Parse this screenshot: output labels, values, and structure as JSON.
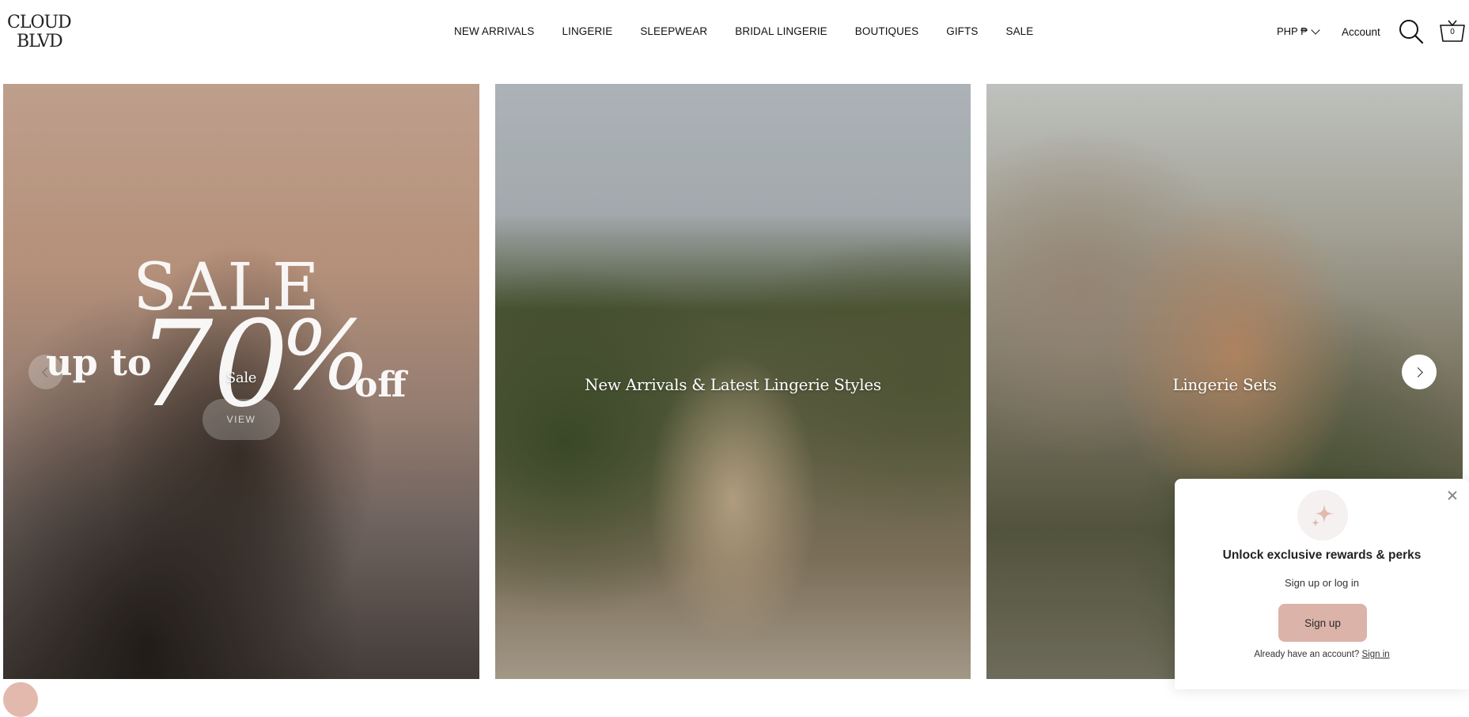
{
  "header": {
    "logo_line1": "CLOUD",
    "logo_line2": "BLVD",
    "nav": [
      "NEW ARRIVALS",
      "LINGERIE",
      "SLEEPWEAR",
      "BRIDAL LINGERIE",
      "BOUTIQUES",
      "GIFTS",
      "SALE"
    ],
    "currency": "PHP ₱",
    "account_label": "Account",
    "cart_count": "0"
  },
  "carousel": {
    "panel1": {
      "sale_word": "SALE",
      "upto": "up to",
      "seventy": "70",
      "percent": "%",
      "off": "off",
      "title": "Sale",
      "view_label": "VIEW"
    },
    "panel2": {
      "title": "New Arrivals & Latest Lingerie Styles"
    },
    "panel3": {
      "title": "Lingerie Sets"
    }
  },
  "popup": {
    "title": "Unlock exclusive rewards & perks",
    "subtitle": "Sign up or log in",
    "button_label": "Sign up",
    "footer_text": "Already have an account?",
    "footer_link": "Sign in",
    "icon": "sparkle-icon"
  },
  "colors": {
    "accent": "#dcb3a9",
    "text": "#111111"
  }
}
